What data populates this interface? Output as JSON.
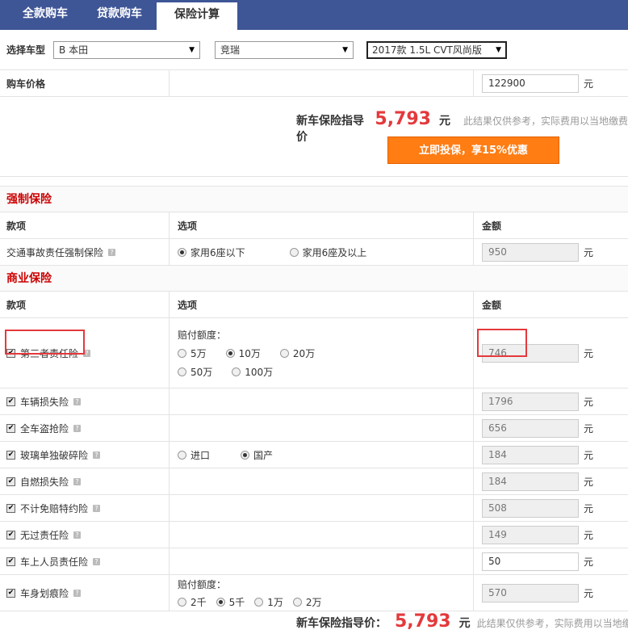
{
  "tabs": [
    "全款购车",
    "贷款购车",
    "保险计算"
  ],
  "select": {
    "label": "选择车型",
    "brand": "B 本田",
    "series": "竞瑞",
    "model": "2017款 1.5L CVT风尚版"
  },
  "price": {
    "label": "购车价格",
    "value": "122900",
    "unit": "元"
  },
  "guide": {
    "label": "新车保险指导价",
    "value": "5,793",
    "unit": "元",
    "note": "此结果仅供参考，实际费用以当地缴费",
    "button": "立即投保，享15%优惠"
  },
  "compulsory": {
    "title": "强制保险",
    "headers": [
      "款项",
      "选项",
      "金额"
    ],
    "item": {
      "name": "交通事故责任强制保险",
      "opt1": "家用6座以下",
      "opt2": "家用6座及以上",
      "amount": "950",
      "unit": "元"
    }
  },
  "commercial": {
    "title": "商业保险",
    "headers": [
      "款项",
      "选项",
      "金额"
    ],
    "third": {
      "name": "第三者责任险",
      "limit_label": "赔付额度：",
      "opts": [
        "5万",
        "10万",
        "20万",
        "50万",
        "100万"
      ],
      "amount": "746"
    },
    "items": [
      {
        "name": "车辆损失险",
        "amount": "1796"
      },
      {
        "name": "全车盗抢险",
        "amount": "656"
      },
      {
        "name": "玻璃单独破碎险",
        "opt1": "进口",
        "opt2": "国产",
        "amount": "184"
      },
      {
        "name": "自燃损失险",
        "amount": "184"
      },
      {
        "name": "不计免赔特约险",
        "amount": "508"
      },
      {
        "name": "无过责任险",
        "amount": "149"
      },
      {
        "name": "车上人员责任险",
        "amount": "50"
      }
    ],
    "scratch": {
      "name": "车身划痕险",
      "limit_label": "赔付额度：",
      "opts": [
        "2千",
        "5千",
        "1万",
        "2万"
      ],
      "amount": "570"
    },
    "unit": "元"
  },
  "footer": {
    "label": "新车保险指导价：",
    "value": "5,793",
    "unit": "元",
    "note": "此结果仅供参考，实际费用以当地缴费"
  }
}
